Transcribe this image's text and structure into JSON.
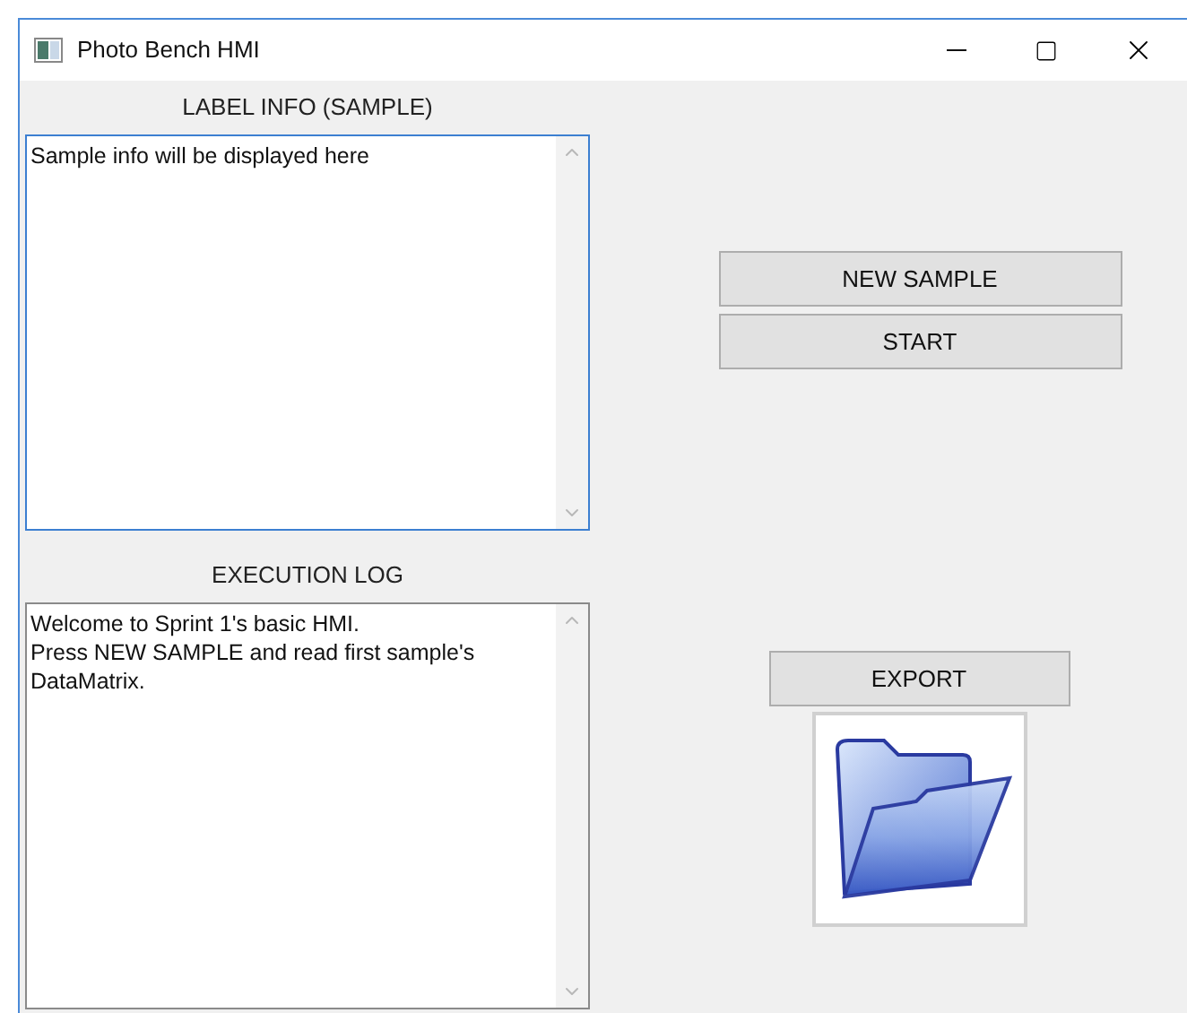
{
  "window": {
    "title": "Photo Bench HMI"
  },
  "panels": [
    {
      "label": "LABEL INFO (SAMPLE)",
      "value": "Sample info will be displayed here",
      "focused": true
    },
    {
      "label": "EXECUTION LOG",
      "value": "Welcome to Sprint 1's basic HMI.\nPress NEW SAMPLE and read first sample's DataMatrix.",
      "focused": false
    }
  ],
  "buttons": [
    "NEW SAMPLE",
    "START"
  ],
  "export": {
    "label": "EXPORT"
  }
}
